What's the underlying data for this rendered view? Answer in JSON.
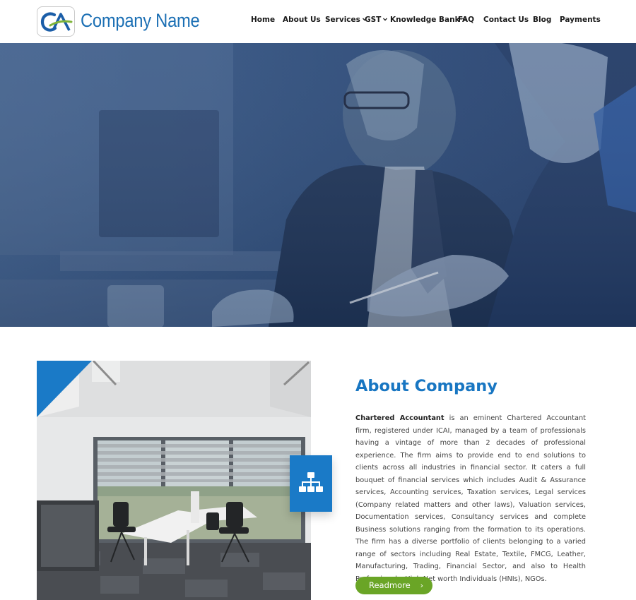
{
  "header": {
    "brand": "Company Name",
    "logo_text": "CA"
  },
  "nav": {
    "items": [
      {
        "label": "Home",
        "dropdown": false
      },
      {
        "label": "About Us",
        "dropdown": false
      },
      {
        "label": "Services",
        "dropdown": true
      },
      {
        "label": "GST",
        "dropdown": true
      },
      {
        "label": "Knowledge Bank",
        "dropdown": true
      },
      {
        "label": "FAQ",
        "dropdown": false
      },
      {
        "label": "Contact Us",
        "dropdown": false
      },
      {
        "label": "Blog",
        "dropdown": false
      },
      {
        "label": "Payments",
        "dropdown": false
      }
    ]
  },
  "about": {
    "title": "About Company",
    "lead": "Chartered Accountant",
    "body": " is an eminent Chartered Accountant firm, registered under ICAI, managed by a team of professionals having a vintage of more than 2 decades of professional experience. The firm aims to provide end to end solutions to clients across all industries in financial sector. It caters a full bouquet of financial services which includes Audit & Assurance services, Accounting services, Taxation services, Legal services (Company related matters and other laws), Valuation services, Documentation services, Consultancy services and complete Business solutions ranging from the formation to its operations. The firm has a diverse portfolio of clients belonging to a varied range of sectors including Real Estate, Textile, FMCG, Leather, Manufacturing, Trading, Financial Sector, and also to Health Professionals, High Net worth Individuals (HNIs), NGOs.",
    "button_label": "Readmore",
    "button_arrow": "›"
  },
  "icons": {
    "logo": "ca-logo-icon",
    "dropdown": "chevron-down-icon",
    "feature": "sitemap-icon"
  },
  "colors": {
    "brand_blue": "#1b6fb4",
    "title_blue": "#1876c2",
    "accent_blue": "#1a7ac7",
    "hero_overlay": "#2f4f80",
    "button_green": "#6aa526"
  }
}
